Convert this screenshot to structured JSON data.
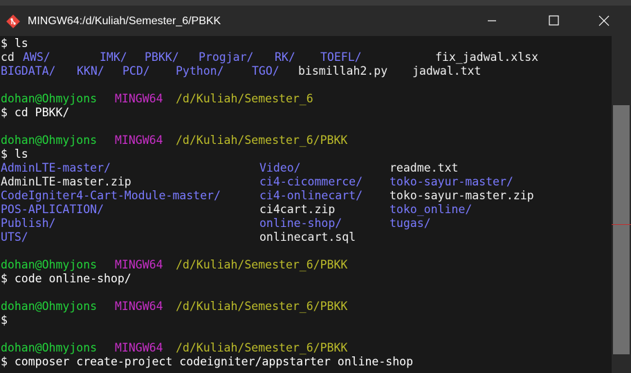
{
  "window": {
    "title": "MINGW64:/d/Kuliah/Semester_6/PBKK"
  },
  "prompt": {
    "user": "dohan@Ohmyjons",
    "system": "MINGW64",
    "path_root": "/d/Kuliah/Semester_6",
    "path_pbkk": "/d/Kuliah/Semester_6/PBKK",
    "symbol": "$"
  },
  "terminal": {
    "line_ls1": "$ ls",
    "listing1": {
      "row1_prefix": "cd ",
      "row1": [
        "AWS/",
        "IMK/",
        "PBKK/",
        "Progjar/",
        "RK/",
        "TOEFL/",
        "fix_jadwal.xlsx"
      ],
      "row2": [
        "BIGDATA/",
        "KKN/",
        "PCD/",
        "Python/",
        "TGO/",
        "bismillah2.py",
        "jadwal.txt"
      ]
    },
    "cmd_cd": "$ cd PBKK/",
    "line_ls2": "$ ls",
    "listing2": {
      "col1": [
        "AdminLTE-master/",
        "AdminLTE-master.zip",
        "CodeIgniter4-Cart-Module-master/",
        "POS-APLICATION/",
        "Publish/",
        "UTS/"
      ],
      "col2": [
        "Video/",
        "ci4-cicommerce/",
        "ci4-onlinecart/",
        "ci4cart.zip",
        "online-shop/",
        "onlinecart.sql"
      ],
      "col3": [
        "readme.txt",
        "toko-sayur-master/",
        "toko-sayur-master.zip",
        "toko_online/",
        "tugas/"
      ]
    },
    "cmd_code": "$ code online-shop/",
    "cmd_empty": "$",
    "cmd_composer": "$ composer create-project codeigniter/appstarter online-shop"
  },
  "colors": {
    "user": "#22d33a",
    "system": "#c72fc7",
    "path": "#bcbc2a",
    "directory": "#7a7aff",
    "file": "#f0f0f0"
  }
}
